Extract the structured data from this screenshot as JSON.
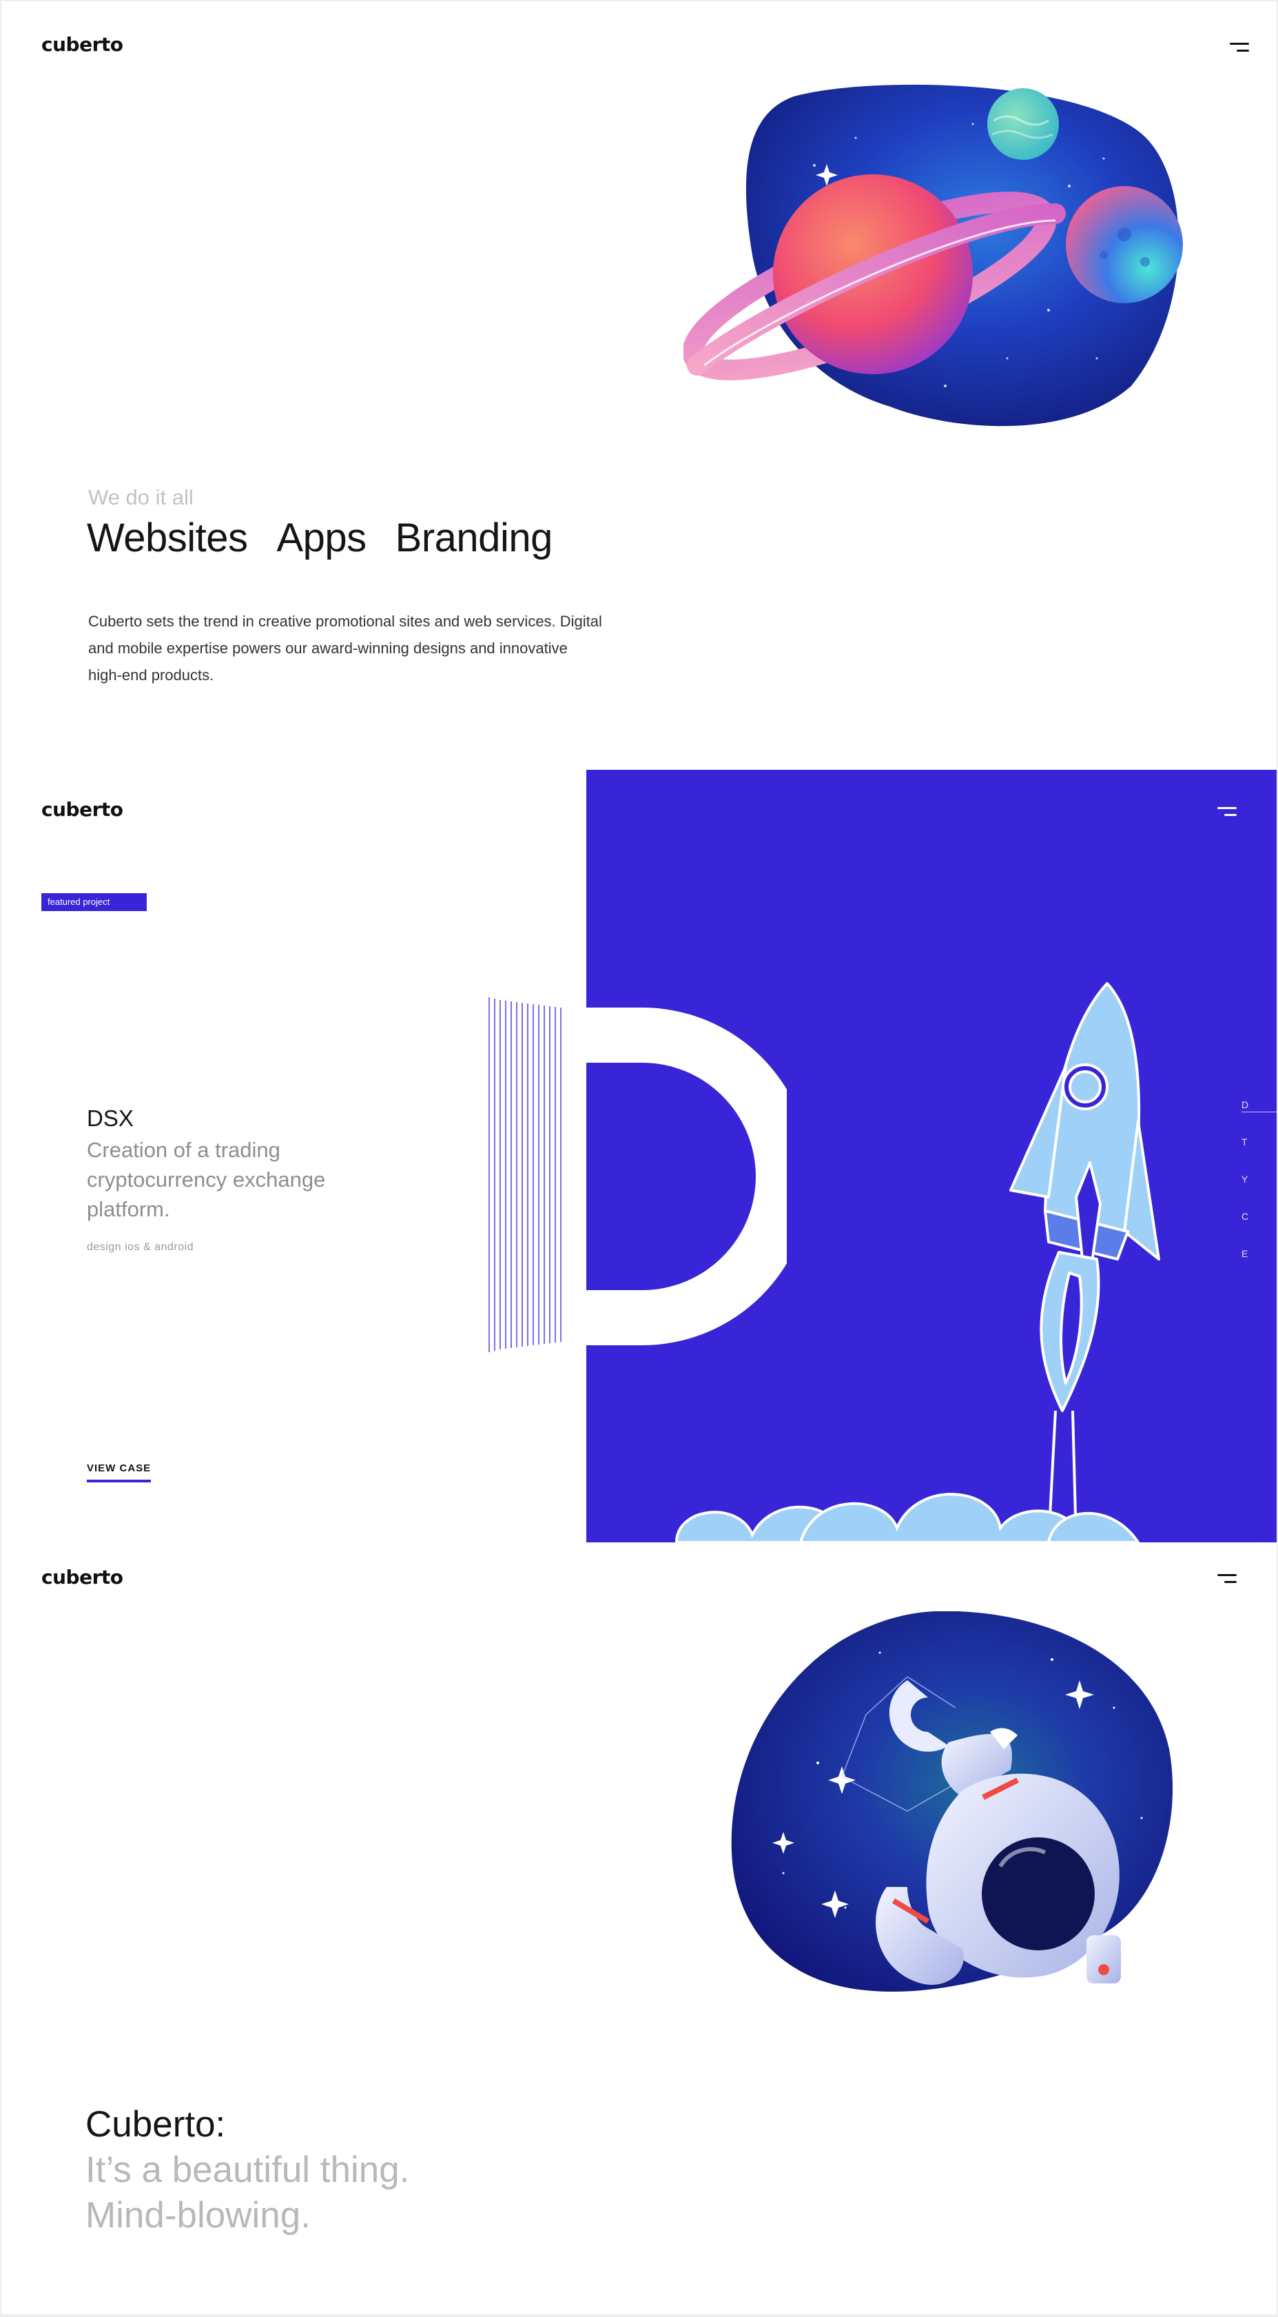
{
  "brand": {
    "logo_text": "cuberto",
    "accent_color": "#3825d7"
  },
  "hero": {
    "eyebrow": "We do it all",
    "services": [
      "Websites",
      "Apps",
      "Branding"
    ],
    "description": "Cuberto sets the trend in creative promotional sites and web services. Digital and mobile expertise powers our award-winning designs and innovative high-end products.",
    "illustration": "planets-illustration"
  },
  "featured": {
    "badge": "featured project",
    "title": "DSX",
    "subtitle": "Creation of a trading cryptocurrency exchange platform.",
    "tags": "design ios & android",
    "cta": "VIEW CASE",
    "side_nav_letters": [
      "D",
      "T",
      "Y",
      "C",
      "E"
    ],
    "illustration": "rocket-illustration",
    "background_color": "#3825d7"
  },
  "closing": {
    "line1": "Cuberto:",
    "line2": "It’s a beautiful thing.",
    "line3": "Mind-blowing.",
    "illustration": "astronaut-illustration"
  },
  "icons": {
    "menu": "menu-icon"
  }
}
